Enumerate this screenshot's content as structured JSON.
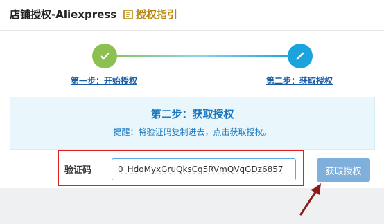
{
  "header": {
    "title": "店铺授权-Aliexpress",
    "guide_link": "授权指引"
  },
  "steps": [
    {
      "label": "第一步：开始授权",
      "icon": "check-icon",
      "color": "#8cc152"
    },
    {
      "label": "第二步：获取授权",
      "icon": "pencil-icon",
      "color": "#1aa3dc"
    }
  ],
  "info": {
    "title": "第二步：获取授权",
    "hint": "提醒：将验证码复制进去，点击获取授权。"
  },
  "form": {
    "code_label": "验证码",
    "code_value": "0_HdoMyxGruQksCq5RVmQVqGDz6857",
    "submit_label": "获取授权"
  },
  "colors": {
    "accent": "#1aa3dc",
    "success": "#8cc152",
    "highlight": "#e02020",
    "link": "#1a5ea8"
  }
}
